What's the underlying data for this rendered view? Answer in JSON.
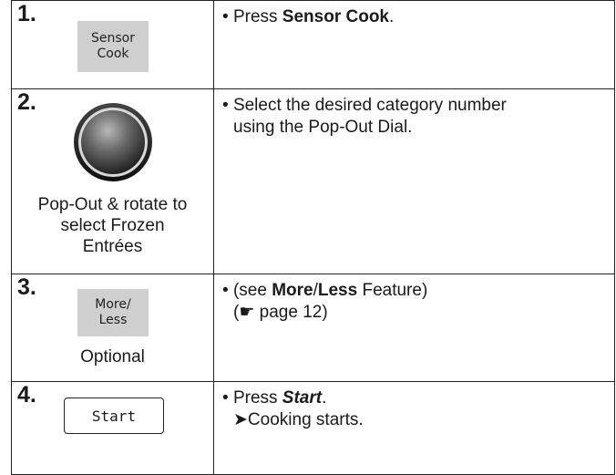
{
  "steps": [
    {
      "number": "1.",
      "key_label_line1": "Sensor",
      "key_label_line2": "Cook",
      "text_prefix": "Press ",
      "text_bold": "Sensor Cook",
      "text_suffix": "."
    },
    {
      "number": "2.",
      "caption_line1": "Pop-Out & rotate to",
      "caption_line2": "select Frozen",
      "caption_line3": "Entrées",
      "text_line1": "Select the desired category number",
      "text_line2": "using the Pop-Out Dial."
    },
    {
      "number": "3.",
      "key_label_line1": "More/",
      "key_label_line2": "Less",
      "caption": "Optional",
      "text_prefix": "(see ",
      "text_bold1": "More",
      "text_slash": "/",
      "text_bold2": "Less",
      "text_suffix": " Feature)",
      "page_ref_prefix": "(",
      "page_ref_icon": "☛",
      "page_ref_text": " page 12)"
    },
    {
      "number": "4.",
      "key_label": "Start",
      "text_prefix": "Press ",
      "text_bold_italic": "Start",
      "text_suffix": ".",
      "result_arrow": "➤",
      "result_text": "Cooking starts."
    }
  ],
  "bullet": "•"
}
